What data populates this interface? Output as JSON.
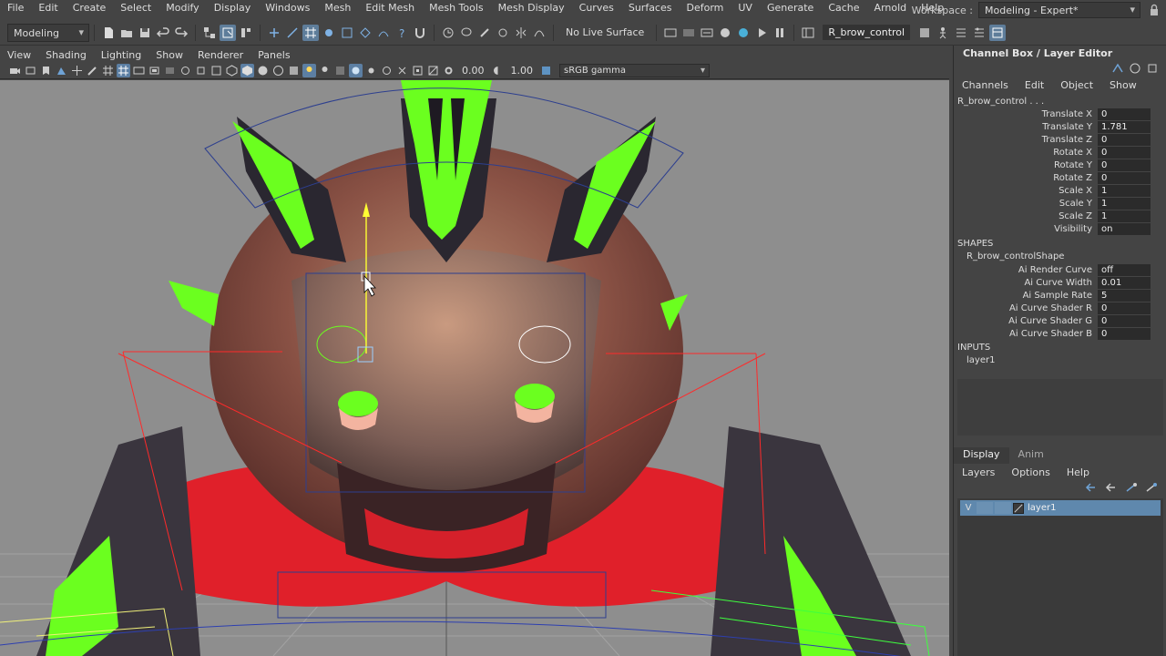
{
  "menubar": {
    "items": [
      "File",
      "Edit",
      "Create",
      "Select",
      "Modify",
      "Display",
      "Windows",
      "Mesh",
      "Edit Mesh",
      "Mesh Tools",
      "Mesh Display",
      "Curves",
      "Surfaces",
      "Deform",
      "UV",
      "Generate",
      "Cache",
      "Arnold",
      "Help"
    ],
    "workspace_label": "Workspace :",
    "workspace_value": "Modeling - Expert*"
  },
  "statusline": {
    "mode": "Modeling",
    "live_surface": "No Live Surface",
    "object_name": "R_brow_control"
  },
  "panel_menu": {
    "items": [
      "View",
      "Shading",
      "Lighting",
      "Show",
      "Renderer",
      "Panels"
    ]
  },
  "panel_toolbar": {
    "exposure": "0.00",
    "gamma": "1.00",
    "color_space": "sRGB gamma"
  },
  "channel_box": {
    "title": "Channel Box / Layer Editor",
    "menu": [
      "Channels",
      "Edit",
      "Object",
      "Show"
    ],
    "node": "R_brow_control . . .",
    "attributes": [
      {
        "label": "Translate X",
        "value": "0"
      },
      {
        "label": "Translate Y",
        "value": "1.781"
      },
      {
        "label": "Translate Z",
        "value": "0"
      },
      {
        "label": "Rotate X",
        "value": "0"
      },
      {
        "label": "Rotate Y",
        "value": "0"
      },
      {
        "label": "Rotate Z",
        "value": "0"
      },
      {
        "label": "Scale X",
        "value": "1"
      },
      {
        "label": "Scale Y",
        "value": "1"
      },
      {
        "label": "Scale Z",
        "value": "1"
      },
      {
        "label": "Visibility",
        "value": "on"
      }
    ],
    "shapes_heading": "SHAPES",
    "shape_node": "R_brow_controlShape",
    "shape_attributes": [
      {
        "label": "Ai Render Curve",
        "value": "off"
      },
      {
        "label": "Ai Curve Width",
        "value": "0.01"
      },
      {
        "label": "Ai Sample Rate",
        "value": "5"
      },
      {
        "label": "Ai Curve Shader R",
        "value": "0"
      },
      {
        "label": "Ai Curve Shader G",
        "value": "0"
      },
      {
        "label": "Ai Curve Shader B",
        "value": "0"
      }
    ],
    "inputs_heading": "INPUTS",
    "input_node": "layer1"
  },
  "layer_editor": {
    "tabs": [
      "Display",
      "Anim"
    ],
    "menu": [
      "Layers",
      "Options",
      "Help"
    ],
    "layers": [
      {
        "visible": "V",
        "name": "layer1"
      }
    ]
  },
  "colors": {
    "accent": "#5e7d9a",
    "layer_selected": "#5f88ad",
    "spike_green": "#6bff1f",
    "body_red": "#e0202a"
  }
}
